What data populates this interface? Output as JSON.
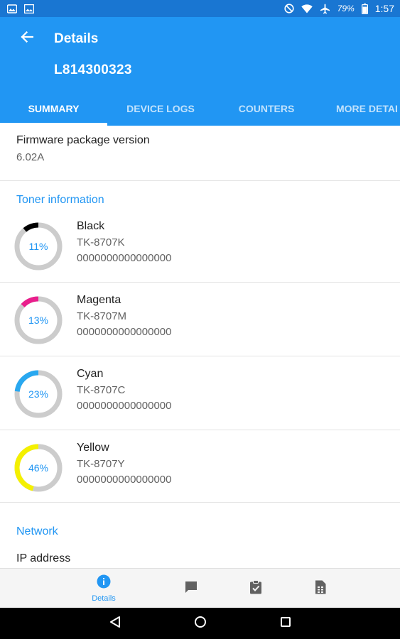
{
  "status_bar": {
    "battery": "79%",
    "time": "1:57",
    "icons": [
      "photo-icon",
      "image-icon",
      "do-not-disturb-icon",
      "wifi-icon",
      "airplane-icon",
      "battery-icon"
    ]
  },
  "app_bar": {
    "title": "Details",
    "subtitle": "L814300323",
    "back_icon": "back-arrow-icon",
    "tabs": [
      {
        "label": "SUMMARY",
        "active": true
      },
      {
        "label": "DEVICE LOGS",
        "active": false
      },
      {
        "label": "COUNTERS",
        "active": false
      },
      {
        "label": "MORE DETAI",
        "active": false
      }
    ]
  },
  "firmware": {
    "label": "Firmware package version",
    "value": "6.02A"
  },
  "toner_section": {
    "title": "Toner information",
    "items": [
      {
        "name": "Black",
        "model": "TK-8707K",
        "serial": "0000000000000000",
        "percent_label": "11%",
        "level": 0.11,
        "color": "#000000"
      },
      {
        "name": "Magenta",
        "model": "TK-8707M",
        "serial": "0000000000000000",
        "percent_label": "13%",
        "level": 0.13,
        "color": "#e91e8c"
      },
      {
        "name": "Cyan",
        "model": "TK-8707C",
        "serial": "0000000000000000",
        "percent_label": "23%",
        "level": 0.23,
        "color": "#29a8f0"
      },
      {
        "name": "Yellow",
        "model": "TK-8707Y",
        "serial": "0000000000000000",
        "percent_label": "46%",
        "level": 0.46,
        "color": "#f4f000"
      }
    ]
  },
  "network_section": {
    "title": "Network",
    "ip_label": "IP address"
  },
  "bottom_nav": {
    "items": [
      {
        "label": "Details",
        "icon": "info-icon",
        "active": true
      },
      {
        "label": "",
        "icon": "message-icon",
        "active": false
      },
      {
        "label": "",
        "icon": "clipboard-check-icon",
        "active": false
      },
      {
        "label": "",
        "icon": "spreadsheet-icon",
        "active": false
      }
    ]
  },
  "colors": {
    "primary": "#2196f3",
    "primary_dark": "#1976d2",
    "ring_track": "#cccccc"
  }
}
